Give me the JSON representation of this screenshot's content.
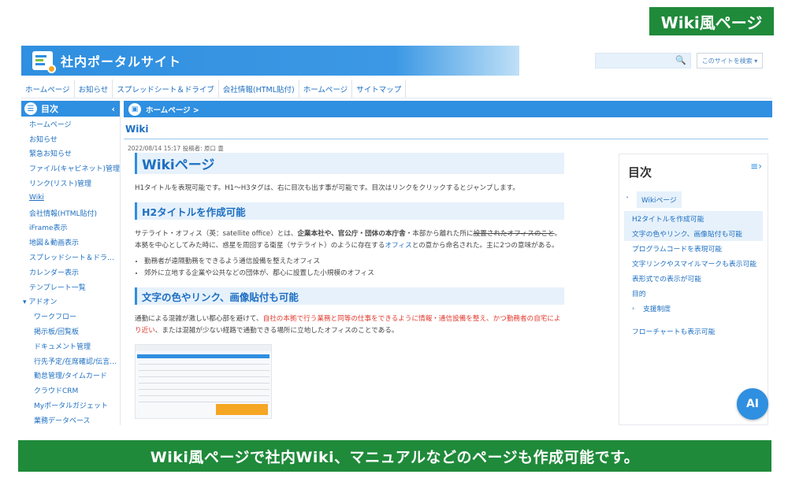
{
  "badge": "Wiki風ページ",
  "banner": "Wiki風ページで社内Wiki、マニュアルなどのページも作成可能です。",
  "header": {
    "site_title": "社内ポータルサイト",
    "search_placeholder": "",
    "search_scope": "このサイトを検索 ▾"
  },
  "nav": [
    "ホームページ",
    "お知らせ",
    "スプレッドシート＆ドライブ",
    "会社情報(HTML貼付)",
    "ホームページ",
    "サイトマップ"
  ],
  "sidebar": {
    "heading": "目次",
    "items": [
      {
        "label": "ホームページ",
        "type": "item"
      },
      {
        "label": "お知らせ",
        "type": "item"
      },
      {
        "label": "緊急お知らせ",
        "type": "item"
      },
      {
        "label": "ファイル(キャビネット)管理",
        "type": "item"
      },
      {
        "label": "リンク(リスト)管理",
        "type": "item"
      },
      {
        "label": "Wiki",
        "type": "active"
      },
      {
        "label": "会社情報(HTML貼付)",
        "type": "item"
      },
      {
        "label": "iFrame表示",
        "type": "item"
      },
      {
        "label": "地図＆動画表示",
        "type": "item"
      },
      {
        "label": "スプレッドシート＆ドラ…",
        "type": "item"
      },
      {
        "label": "カレンダー表示",
        "type": "item"
      },
      {
        "label": "テンプレート一覧",
        "type": "item"
      },
      {
        "label": "▾ アドオン",
        "type": "group"
      },
      {
        "label": "ワークフロー",
        "type": "sub"
      },
      {
        "label": "掲示板/回覧板",
        "type": "sub"
      },
      {
        "label": "ドキュメント管理",
        "type": "sub"
      },
      {
        "label": "行先予定/在席確認/伝言…",
        "type": "sub"
      },
      {
        "label": "勤怠管理/タイムカード",
        "type": "sub"
      },
      {
        "label": "クラウドCRM",
        "type": "sub"
      },
      {
        "label": "Myポータルガジェット",
        "type": "sub"
      },
      {
        "label": "業務データベース",
        "type": "sub"
      }
    ]
  },
  "content": {
    "breadcrumb": "ホームページ >",
    "page_title": "Wiki",
    "meta": "2022/08/14 15:17 投稿者: 原口 豊",
    "h1": "Wikiページ",
    "p1": "H1タイトルを表現可能です。H1～H3タグは、右に目次も出す事が可能です。目次はリンクをクリックするとジャンプします。",
    "h2a": "H2タイトルを作成可能",
    "p2": {
      "t1": "サテライト・オフィス（英：satellite office）とは、",
      "t2": "企業本社や、官公庁・団体の本庁舎",
      "t3": "・本部から離れた所に",
      "t4": "設置されたオフィスのこと",
      "t5": "。本拠を中心としてみた時に、惑星を周回する衛星（サテライト）のように存在する",
      "t6": "オフィス",
      "t7": "との意から命名された。主に2つの意味がある。"
    },
    "bullets": [
      "勤務者が遠隔勤務をできるよう通信設備を整えたオフィス",
      "郊外に立地する企業や公共などの団体が、都心に設置した小規模のオフィス"
    ],
    "h2b": "文字の色やリンク、画像貼付も可能",
    "p3": {
      "t1": "通勤による混雑が激しい都心部を避けて、",
      "t2": "自社の本拠で行う業務と同等の仕事をできるように情報・通信設備を整え、かつ勤務者の自宅により近い",
      "t3": "、または混雑が少ない経路で通勤できる場所に立地したオフィスのことである。"
    }
  },
  "toc": {
    "title": "目次",
    "items": [
      {
        "label": "Wikiページ",
        "level": "h1"
      },
      {
        "label": "H2タイトルを作成可能",
        "level": "hl"
      },
      {
        "label": "文字の色やリンク、画像貼付も可能",
        "level": "hl"
      },
      {
        "label": "プログラムコードを表現可能",
        "level": "h2"
      },
      {
        "label": "文字リンクやスマイルマークも表示可能",
        "level": "h2"
      },
      {
        "label": "表形式での表示が可能",
        "level": "h2"
      },
      {
        "label": "目的",
        "level": "h2"
      },
      {
        "label": "支援制度",
        "level": "h2c"
      },
      {
        "label": "",
        "level": "gap"
      },
      {
        "label": "フローチャートも表示可能",
        "level": "h2"
      }
    ]
  },
  "ai_button": "AI"
}
